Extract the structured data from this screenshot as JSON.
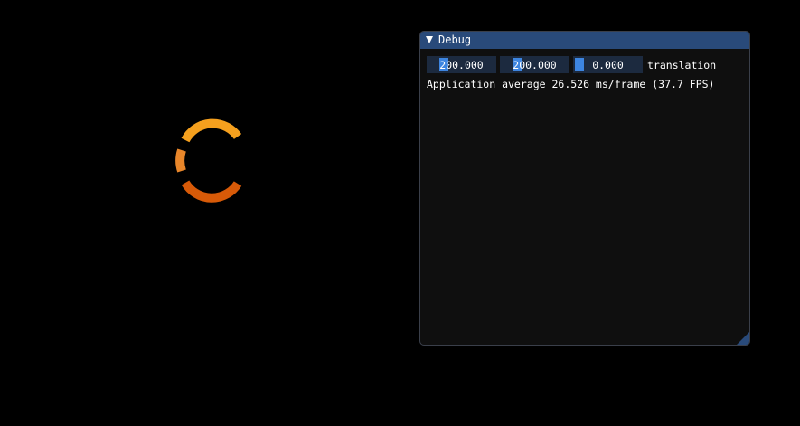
{
  "window": {
    "title": "Debug"
  },
  "translation": {
    "x": "200.000",
    "y": "200.000",
    "z": "0.000",
    "label": "translation"
  },
  "status": {
    "fps_text": "Application average 26.526 ms/frame (37.7 FPS)"
  },
  "colors": {
    "title_bar": "#294a7a",
    "widget_bg": "#1c2a3f",
    "grab": "#3d85e0",
    "arc_top": "#f5a01e",
    "arc_left": "#e8862a",
    "arc_bottom": "#d75a08"
  },
  "icons": {
    "collapse": "triangle-down-icon",
    "resize": "resize-grip-icon"
  }
}
